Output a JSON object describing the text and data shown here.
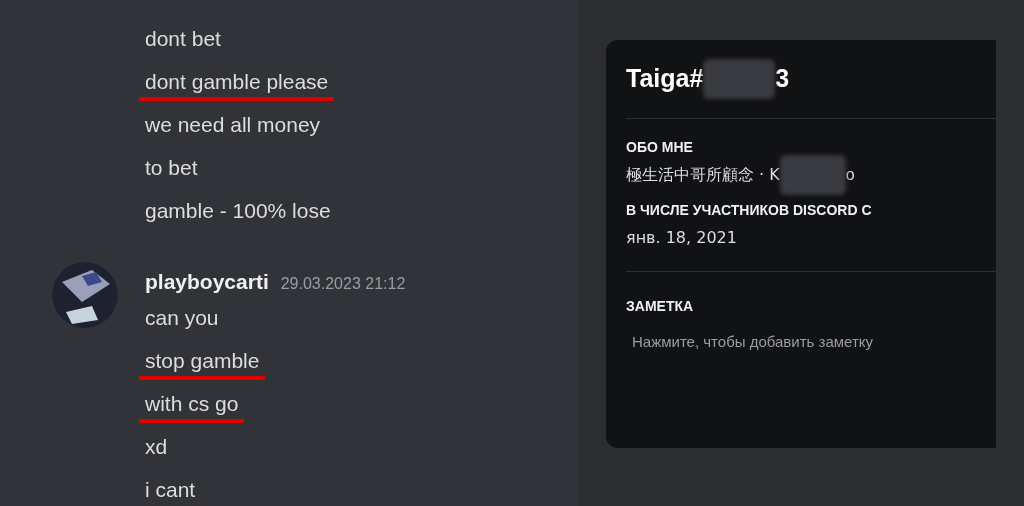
{
  "chat": {
    "continued_messages": [
      {
        "text": "dont bet",
        "underlined": false
      },
      {
        "text": "dont gamble please",
        "underlined": true
      },
      {
        "text": "we need all money",
        "underlined": false
      },
      {
        "text": "to bet",
        "underlined": false
      },
      {
        "text": "gamble - 100% lose",
        "underlined": false
      }
    ],
    "message_group": {
      "author": "playboycarti",
      "timestamp": "29.03.2023 21:12",
      "messages": [
        {
          "text": "can you",
          "underlined": false
        },
        {
          "text": "stop gamble",
          "underlined": true
        },
        {
          "text": "with cs go",
          "underlined": true
        },
        {
          "text": "xd",
          "underlined": false
        },
        {
          "text": "i cant",
          "underlined": false
        }
      ]
    }
  },
  "profile": {
    "username_start": "Taiga#",
    "username_end": "3",
    "sections": [
      {
        "heading": "ОБО МНЕ",
        "text_start": "極生活中哥所顧念 · K",
        "text_end": "o"
      },
      {
        "heading": "В ЧИСЛЕ УЧАСТНИКОВ DISCORD С",
        "text_start": "янв. 18, 2021"
      }
    ],
    "note": {
      "heading": "ЗАМЕТКА",
      "placeholder": "Нажмите, чтобы добавить заметку"
    }
  }
}
